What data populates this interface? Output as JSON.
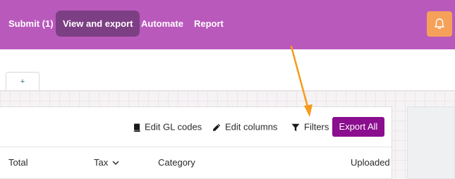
{
  "nav": {
    "items": [
      {
        "label": "Submit (1)"
      },
      {
        "label": "View and export"
      },
      {
        "label": "Automate"
      },
      {
        "label": "Report"
      }
    ],
    "active_index": 1
  },
  "notifications": {
    "icon": "bell-icon"
  },
  "tabs": {
    "add_label": "+"
  },
  "toolbar": {
    "edit_gl_codes": "Edit GL codes",
    "edit_columns": "Edit columns",
    "filters": "Filters",
    "export_all": "Export All"
  },
  "table": {
    "columns": [
      "Total",
      "Tax",
      "Category",
      "Uploaded"
    ]
  },
  "colors": {
    "header_bg": "#b959bc",
    "nav_active_bg": "#7d3f84",
    "notification_bg": "#f5a15a",
    "export_button": "#8a0e8e",
    "annotation_arrow": "#f59b1c"
  }
}
